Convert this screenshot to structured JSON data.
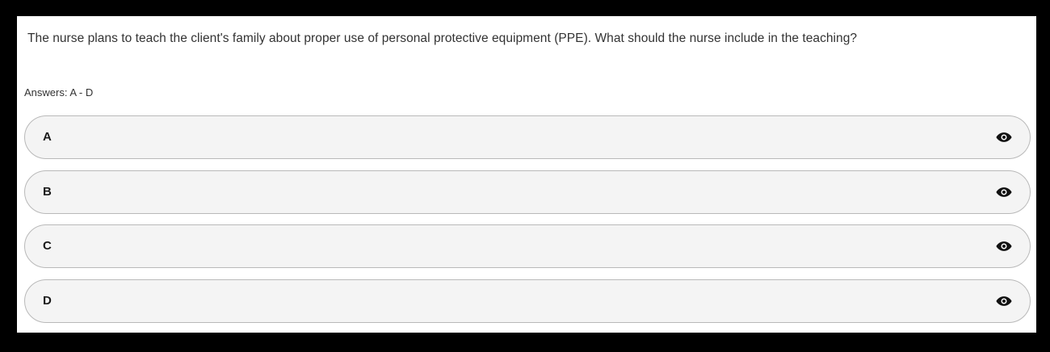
{
  "question": {
    "text": "The nurse plans to teach the client's family about proper use of personal protective equipment (PPE). What should the nurse include in the teaching?"
  },
  "answers": {
    "label": "Answers: A - D"
  },
  "options": [
    {
      "letter": "A",
      "icon": "eye-icon"
    },
    {
      "letter": "B",
      "icon": "eye-icon"
    },
    {
      "letter": "C",
      "icon": "eye-icon"
    },
    {
      "letter": "D",
      "icon": "eye-icon"
    }
  ],
  "colors": {
    "page_background": "#000000",
    "panel_background": "#ffffff",
    "option_background": "#f4f4f4",
    "option_border": "#b9b9b9",
    "text": "#333333"
  }
}
